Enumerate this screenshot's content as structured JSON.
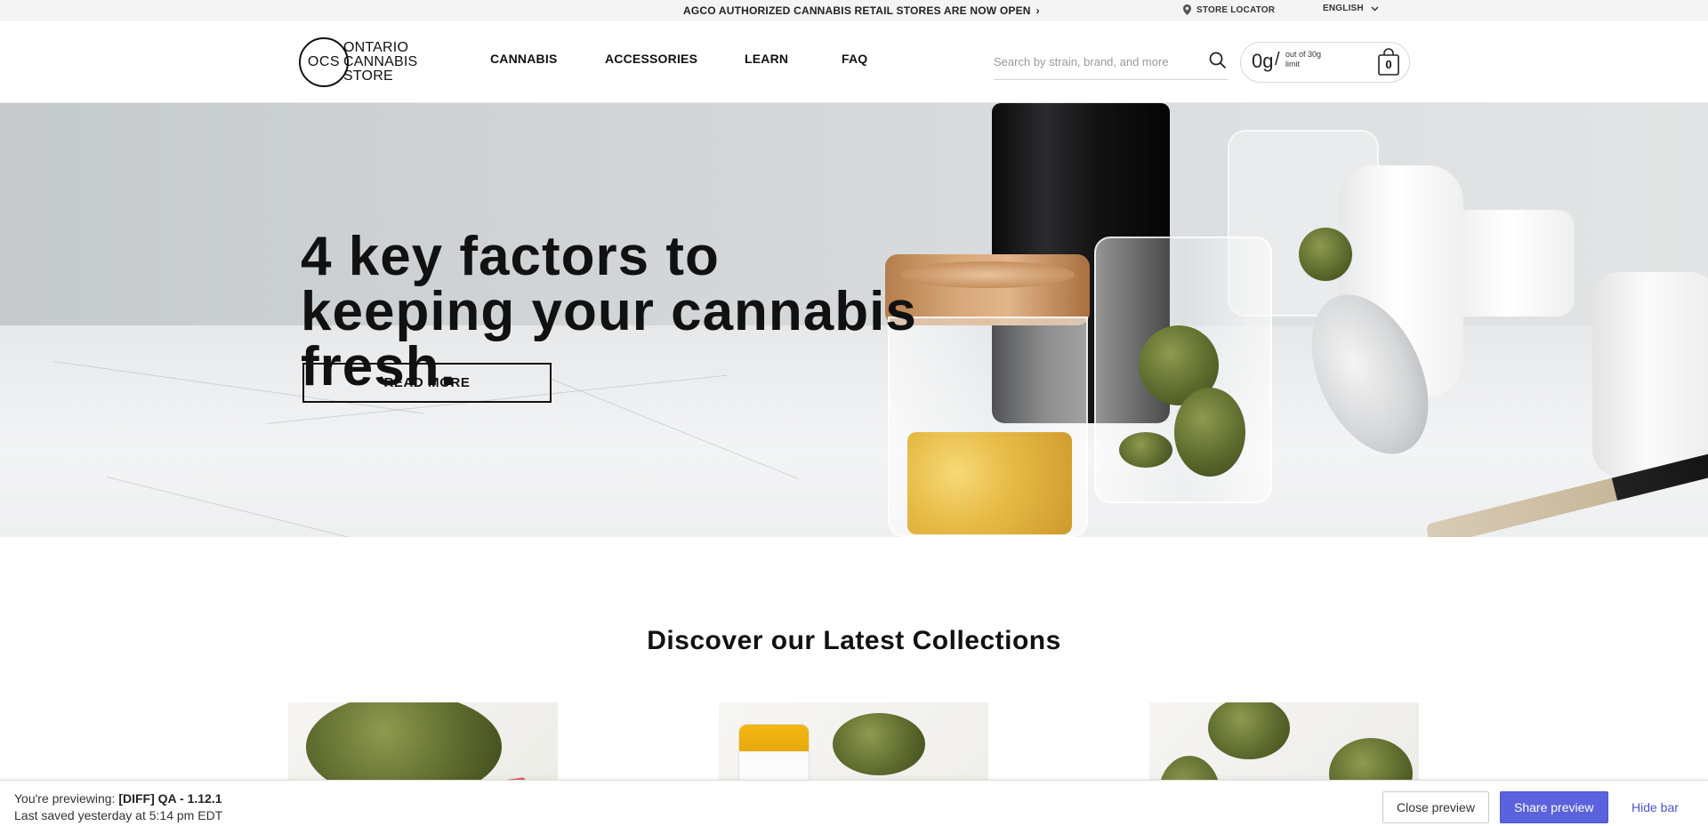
{
  "topbar": {
    "announcement": "AGCO Authorized Cannabis Retail Stores Are Now Open",
    "store_locator": "Store Locator",
    "language": "English"
  },
  "header": {
    "logo": {
      "circle": "OCS",
      "line1": "ONTARIO",
      "line2": "CANNABIS",
      "line3": "STORE"
    },
    "nav": [
      "Cannabis",
      "Accessories",
      "Learn",
      "FAQ"
    ],
    "search_placeholder": "Search by strain, brand, and more",
    "limit": {
      "amount": "0g",
      "separator": "/",
      "text": "out of 30g limit"
    },
    "cart_count": "0"
  },
  "hero": {
    "title": "4 key factors to keeping your cannabis fresh.",
    "cta": "Read More"
  },
  "collections": {
    "title": "Discover our Latest Collections"
  },
  "preview_bar": {
    "label": "You're previewing:",
    "name": "[DIFF] QA - 1.12.1",
    "saved": "Last saved yesterday at 5:14 pm EDT",
    "close": "Close preview",
    "share": "Share preview",
    "hide": "Hide bar",
    "accent_color": "#5a62de"
  }
}
